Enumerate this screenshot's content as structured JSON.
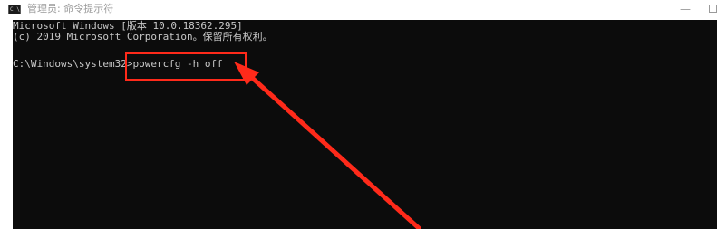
{
  "window": {
    "title": "管理员: 命令提示符",
    "icon": "cmd-icon",
    "icon_glyph": "C:\\"
  },
  "controls": {
    "minimize_glyph": "—",
    "maximize_icon": "maximize-icon"
  },
  "console": {
    "lines": [
      "Microsoft Windows [版本 10.0.18362.295]",
      "(c) 2019 Microsoft Corporation。保留所有权利。",
      "C:\\Windows\\system32>powercfg -h off"
    ]
  },
  "annotation": {
    "color": "#ff2a1a"
  }
}
